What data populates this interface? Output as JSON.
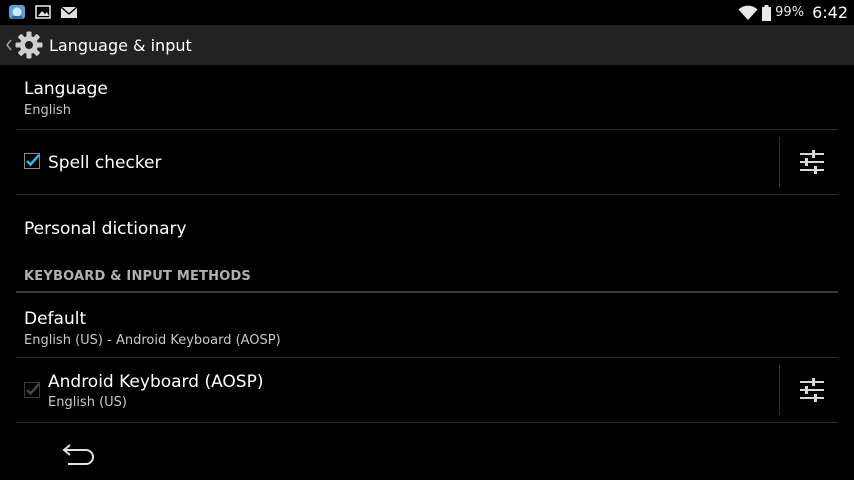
{
  "status_bar": {
    "notification_icons": [
      "app-notification-icon",
      "gallery-icon",
      "email-icon"
    ],
    "wifi_icon": "wifi-icon",
    "battery": "99%",
    "time": "6:42"
  },
  "action_bar": {
    "up_icon": "chevron-left-icon",
    "app_icon": "gear-icon",
    "title": "Language & input"
  },
  "settings": {
    "language": {
      "title": "Language",
      "summary": "English"
    },
    "spell_checker": {
      "title": "Spell checker",
      "checked": true
    },
    "personal_dictionary": {
      "title": "Personal dictionary"
    },
    "section_keyboard": {
      "header": "KEYBOARD & INPUT METHODS"
    },
    "default_keyboard": {
      "title": "Default",
      "summary": "English (US) - Android Keyboard (AOSP)"
    },
    "android_keyboard": {
      "title": "Android Keyboard (AOSP)",
      "summary": "English (US)",
      "checked": true,
      "enabled": false
    }
  },
  "colors": {
    "accent": "#33b5e5",
    "action_bar_bg": "#222222",
    "divider": "#2e2e2e"
  },
  "navigation_bar": {
    "back_icon": "back-arrow-icon"
  }
}
